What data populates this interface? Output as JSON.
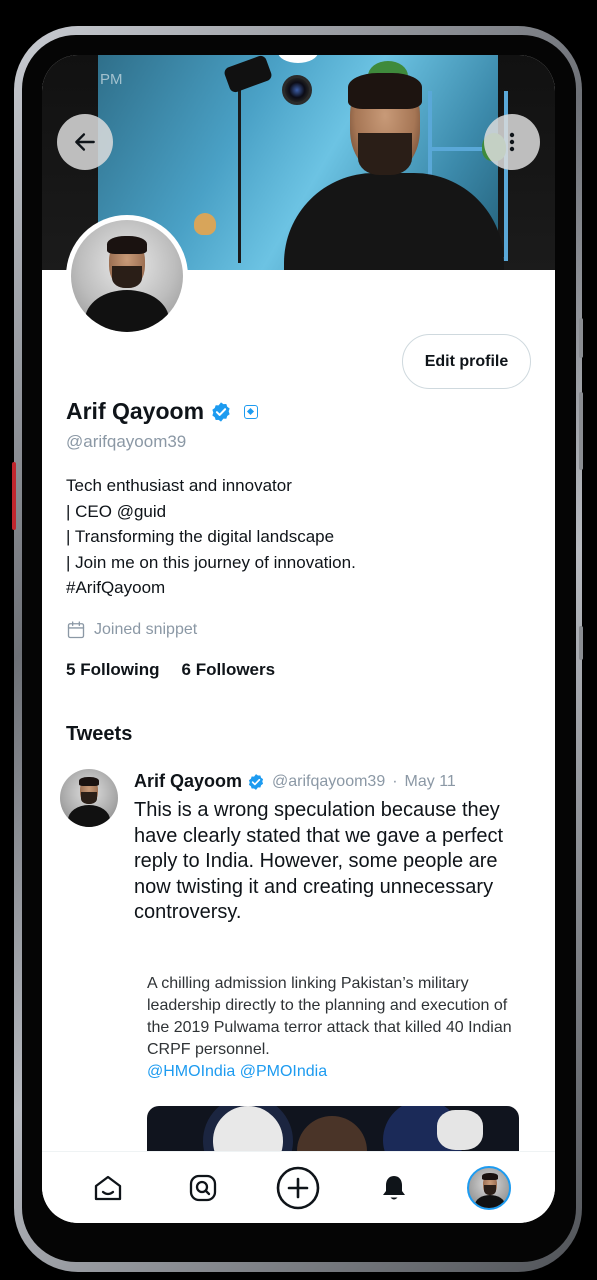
{
  "status_bar": {
    "time": "PM"
  },
  "profile": {
    "name": "Arif Qayoom",
    "handle": "@arifqayoom39",
    "edit_label": "Edit profile",
    "bio_lines": [
      "Tech enthusiast and innovator",
      "| CEO @guid",
      "| Transforming the digital landscape",
      "| Join me on this journey of innovation.",
      "#ArifQayoom"
    ],
    "joined": "Joined snippet",
    "following_count": "5",
    "following_label": "Following",
    "followers_count": "6",
    "followers_label": "Followers"
  },
  "tweets_section": {
    "title": "Tweets"
  },
  "tweet": {
    "author": "Arif Qayoom",
    "handle": "@arifqayoom39",
    "separator": "·",
    "date": "May 11",
    "text": "This is a wrong speculation because they have clearly stated that we gave a perfect reply to India. However, some people are now twisting it and creating unnecessary controversy.",
    "quote_text": "A chilling admission linking Pakistan’s military leadership directly to the planning and execution of the 2019 Pulwama terror attack that killed 40 Indian CRPF personnel.",
    "quote_mentions": "@HMOIndia @PMOIndia"
  },
  "icons": {
    "back": "arrow-left-icon",
    "more": "more-vertical-icon",
    "verified": "verified-badge-icon",
    "calendar": "calendar-icon",
    "home": "home-icon",
    "search": "search-icon",
    "compose": "compose-plus-icon",
    "notifications": "bell-icon",
    "profile": "profile-avatar"
  },
  "colors": {
    "accent": "#1d9bf0",
    "text": "#0f1419",
    "muted": "#8b98a5"
  }
}
